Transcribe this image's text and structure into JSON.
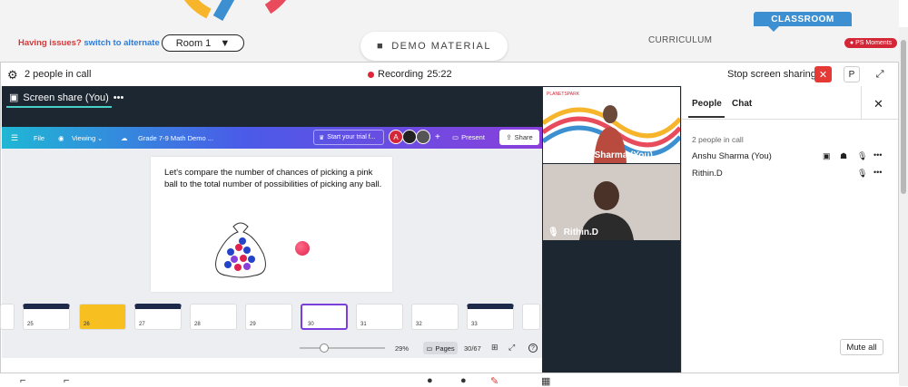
{
  "banner": {
    "issues_text": "Having issues?",
    "switch_link": "switch to alternate room",
    "room_label": "Room 1",
    "demo_label": "DEMO MATERIAL",
    "curriculum_label": "CURRICULUM",
    "classroom_label": "CLASSROOM",
    "ps_moments_label": "PS Moments"
  },
  "call_header": {
    "people_count": "2 people in call",
    "recording_label": "Recording",
    "recording_time": "25:22",
    "stop_share_label": "Stop screen sharing",
    "p_button": "P"
  },
  "screen_share": {
    "tab_label": "Screen share (You)",
    "canva": {
      "file_label": "File",
      "viewing_label": "Viewing",
      "doc_title": "Grade 7-9 Math Demo ...",
      "trial_label": "Start your trial f...",
      "avatar_a": "A",
      "plus": "+",
      "present_label": "Present",
      "share_label": "Share"
    },
    "slide_text": "Let's compare the number of chances of picking a pink ball to the total number of possibilities of picking any ball.",
    "thumbnails": [
      "25",
      "26",
      "27",
      "28",
      "29",
      "30",
      "31",
      "32",
      "33"
    ],
    "active_thumbnail": "30",
    "zoom_percent": "29%",
    "pages_label": "Pages",
    "page_indicator": "30/67",
    "help": "?"
  },
  "videos": [
    {
      "name": "Anshu Sharma (You)"
    },
    {
      "name": "Rithin.D"
    }
  ],
  "panel": {
    "tab_people": "People",
    "tab_chat": "Chat",
    "people_in_call": "2 people in call",
    "participants": [
      "Anshu Sharma (You)",
      "Rithin.D"
    ],
    "mute_all": "Mute all"
  },
  "colors": {
    "recording_dot": "#e0243a",
    "stop_button": "#e53935",
    "classroom_tab": "#3c8fd0",
    "canva_gradient_start": "#1fb7d4",
    "canva_gradient_end": "#8a3fdc"
  }
}
